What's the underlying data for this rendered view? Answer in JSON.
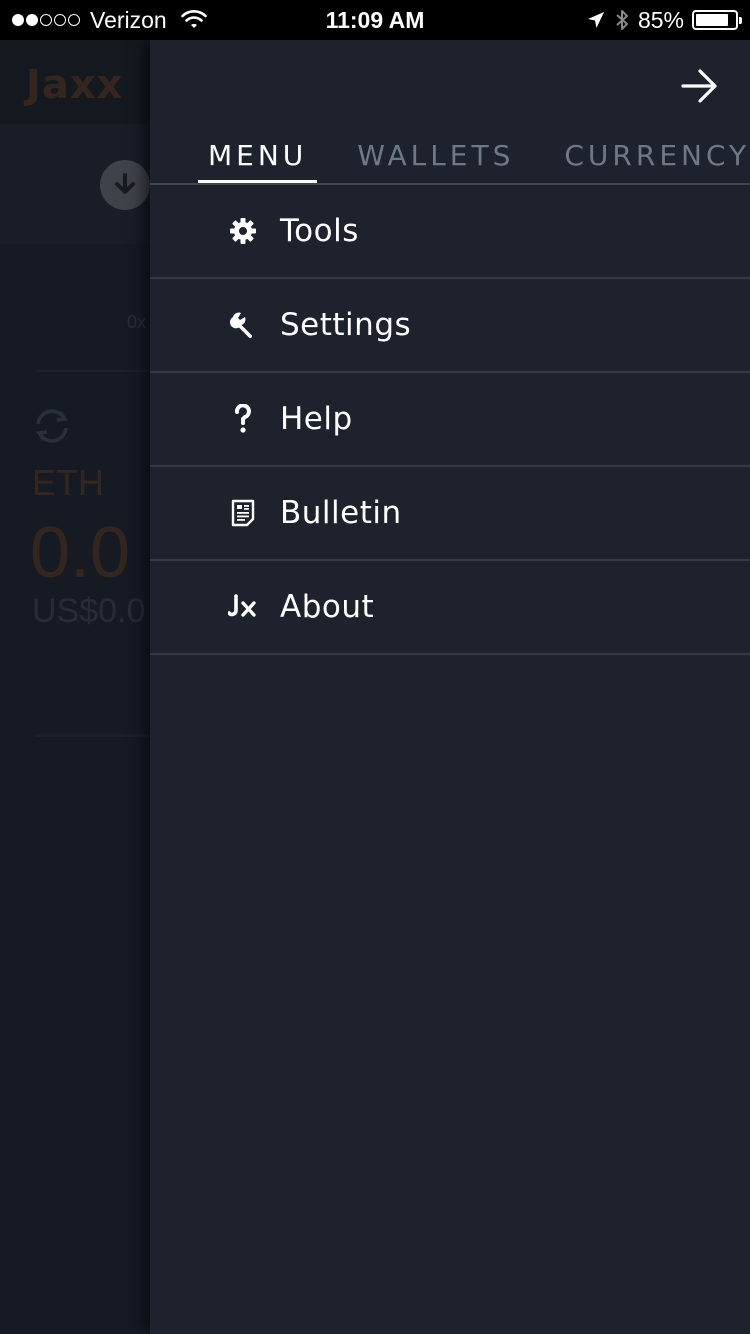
{
  "status_bar": {
    "carrier": "Verizon",
    "time": "11:09 AM",
    "battery": "85%",
    "battery_level": 0.85,
    "signal_dots_filled": 2,
    "signal_dots_total": 5
  },
  "background_app": {
    "logo": "Jaxx",
    "address_fragment": "0x",
    "coin_symbol": "ETH",
    "balance_fragment": "0.0",
    "fiat_fragment": "US$0.0"
  },
  "drawer": {
    "tabs": [
      {
        "label": "MENU",
        "active": true
      },
      {
        "label": "WALLETS",
        "active": false
      },
      {
        "label": "CURRENCY",
        "active": false
      }
    ],
    "menu_items": [
      {
        "label": "Tools",
        "icon": "gear-icon"
      },
      {
        "label": "Settings",
        "icon": "wrench-icon"
      },
      {
        "label": "Help",
        "icon": "question-icon"
      },
      {
        "label": "Bulletin",
        "icon": "document-icon"
      },
      {
        "label": "About",
        "icon": "jaxx-logo-icon"
      }
    ]
  },
  "colors": {
    "drawer_bg": "#1d222c",
    "background_app": "#1c222b",
    "accent_brown": "#4b3426",
    "divider": "#353c47",
    "inactive_tab": "#6f7885"
  }
}
